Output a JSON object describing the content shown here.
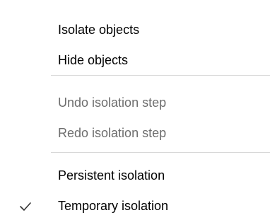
{
  "menu": {
    "items": [
      {
        "label": "Isolate objects",
        "enabled": true,
        "checked": false
      },
      {
        "label": "Hide objects",
        "enabled": true,
        "checked": false
      },
      {
        "label": "Undo isolation step",
        "enabled": false,
        "checked": false
      },
      {
        "label": "Redo isolation step",
        "enabled": false,
        "checked": false
      },
      {
        "label": "Persistent isolation",
        "enabled": true,
        "checked": false
      },
      {
        "label": "Temporary isolation",
        "enabled": true,
        "checked": true
      }
    ],
    "colors": {
      "text": "#000000",
      "disabled_text": "#6d6d6d",
      "separator": "#d7d7d7",
      "checkmark": "#333333",
      "background": "#ffffff"
    }
  }
}
